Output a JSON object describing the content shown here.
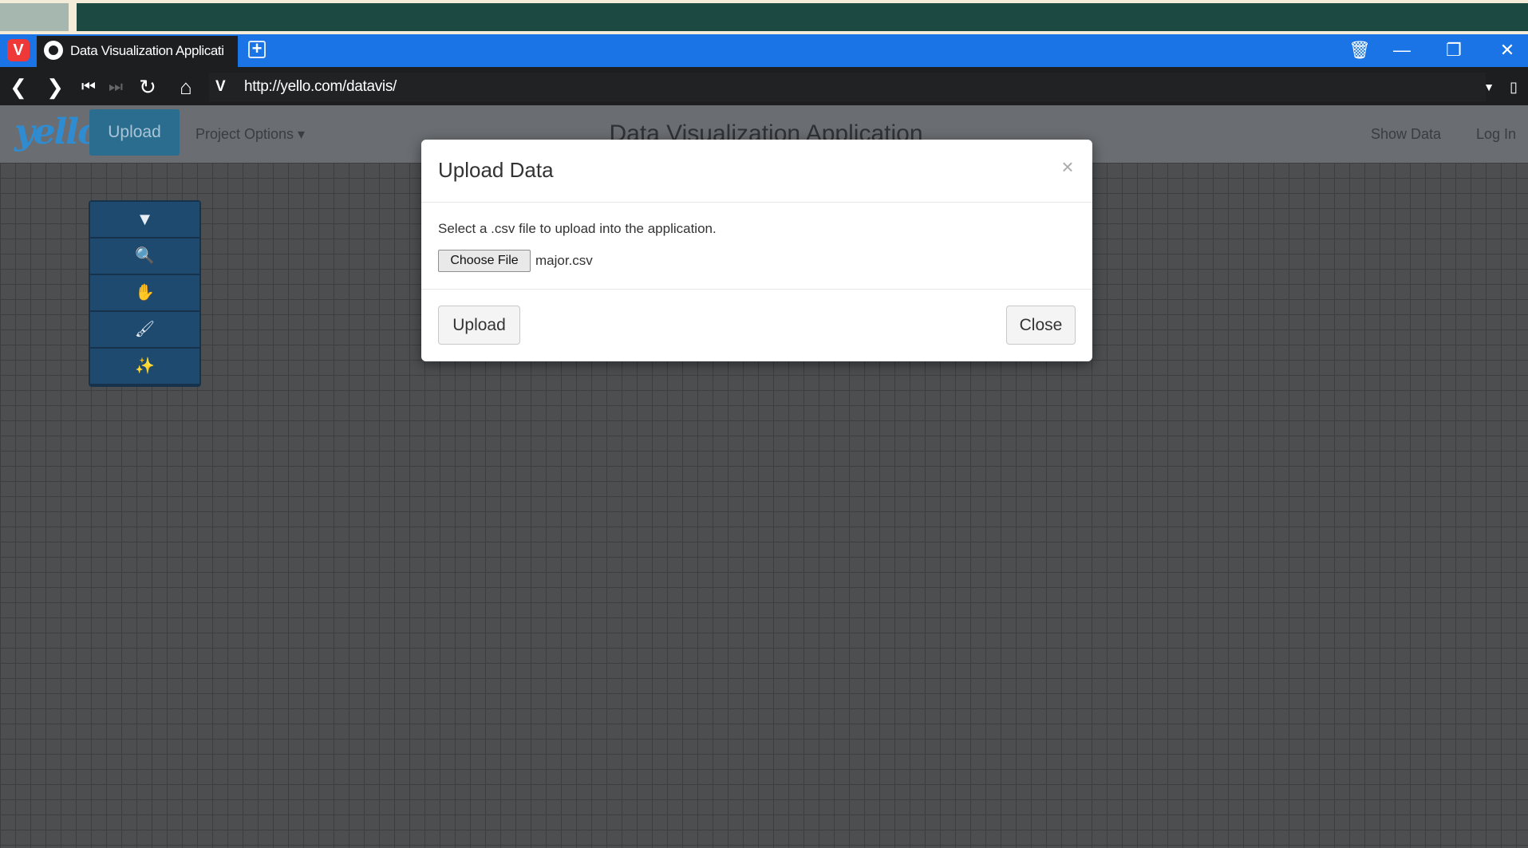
{
  "browser": {
    "tab_title": "Data Visualization Applicati",
    "logo_letter": "V",
    "new_tab_symbol": "+",
    "url_prefix": "V",
    "url": "http://yello.com/datavis/",
    "icons": {
      "trash": "🗑",
      "minimize": "—",
      "restore": "❐",
      "close": "✕",
      "back": "❮",
      "forward": "❯",
      "rewind": "⏮",
      "fast_forward": "⏭",
      "reload": "↻",
      "home": "⌂",
      "dropdown": "▼",
      "bookmark": "▯"
    }
  },
  "app": {
    "brand": "yello",
    "nav_upload": "Upload",
    "project_options": "Project Options ▾",
    "title": "Data Visualization Application",
    "show_data": "Show Data",
    "log_in": "Log In"
  },
  "toolbox": {
    "tools": [
      {
        "name": "filter",
        "glyph": "▼"
      },
      {
        "name": "search",
        "glyph": "🔍"
      },
      {
        "name": "pan",
        "glyph": "✋"
      },
      {
        "name": "brush",
        "glyph": "🖌"
      },
      {
        "name": "magic-wand",
        "glyph": "✨"
      }
    ]
  },
  "modal": {
    "title": "Upload Data",
    "close_x": "×",
    "description": "Select a .csv file to upload into the application.",
    "choose_file": "Choose File",
    "file_name": "major.csv",
    "upload_button": "Upload",
    "close_button": "Close"
  },
  "colors": {
    "tab_bar": "#1a74e6",
    "address_bar": "#1c1e20",
    "navbar": "#6a6d71",
    "brand": "#2f8cd0",
    "upload_button": "#2a6d8f",
    "toolbox": "#1e4a70",
    "workspace": "#4c4e50"
  }
}
